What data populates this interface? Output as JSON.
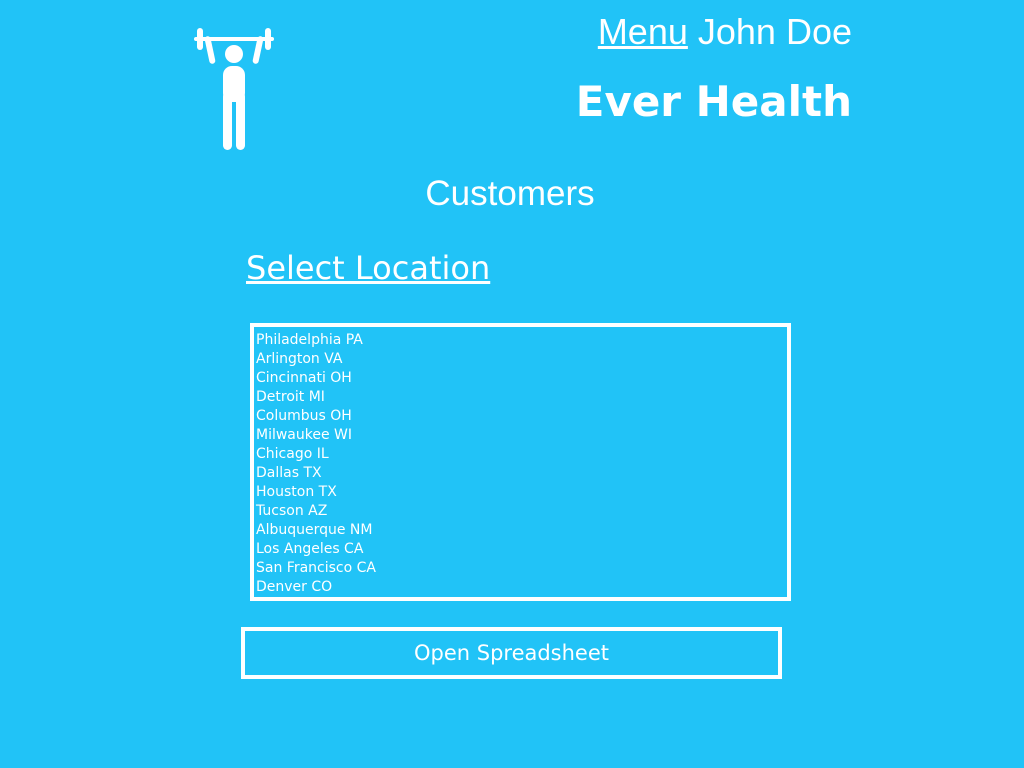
{
  "header": {
    "logo_icon": "weightlifter-icon",
    "menu_label": "Menu",
    "user_name": "John Doe",
    "brand": "Ever Health"
  },
  "page": {
    "heading": "Customers",
    "section_title": "Select Location"
  },
  "locations": [
    "Philadelphia PA",
    "Arlington VA",
    "Cincinnati OH",
    "Detroit MI",
    "Columbus OH",
    "Milwaukee WI",
    "Chicago IL",
    "Dallas TX",
    "Houston TX",
    "Tucson AZ",
    "Albuquerque NM",
    "Los Angeles CA",
    "San Francisco CA",
    "Denver CO"
  ],
  "actions": {
    "open_label": "Open Spreadsheet"
  },
  "colors": {
    "background": "#21c3f7",
    "foreground": "#ffffff"
  }
}
